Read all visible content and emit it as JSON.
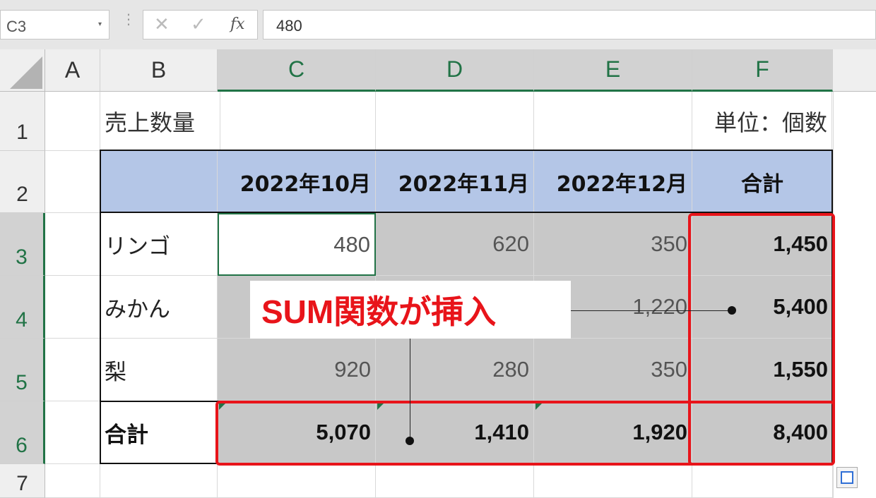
{
  "formula_bar": {
    "name_box": "C3",
    "dropdown_glyph": "▾",
    "dots_glyph": "⋮",
    "cancel_glyph": "✕",
    "enter_glyph": "✓",
    "fx_glyph": "fx",
    "formula": "480"
  },
  "columns": [
    "A",
    "B",
    "C",
    "D",
    "E",
    "F"
  ],
  "rows": [
    "1",
    "2",
    "3",
    "4",
    "5",
    "6",
    "7"
  ],
  "sheet": {
    "title": "売上数量",
    "unit": "単位：個数",
    "headers": [
      "2022年10月",
      "2022年11月",
      "2022年12月",
      "合計"
    ],
    "items": [
      {
        "name": "リンゴ",
        "values": [
          "480",
          "620",
          "350"
        ],
        "total": "1,450"
      },
      {
        "name": "みかん",
        "values": [
          "",
          "",
          "1,220"
        ],
        "total": "5,400"
      },
      {
        "name": "梨",
        "values": [
          "920",
          "280",
          "350"
        ],
        "total": "1,550"
      }
    ],
    "total_row": {
      "label": "合計",
      "values": [
        "5,070",
        "1,410",
        "1,920"
      ],
      "total": "8,400"
    }
  },
  "callout": "SUM関数が挿入",
  "colors": {
    "accent_green": "#217346",
    "highlight_red": "#e8141a",
    "header_blue": "#b4c6e7",
    "selection_gray": "#c8c8c8"
  }
}
